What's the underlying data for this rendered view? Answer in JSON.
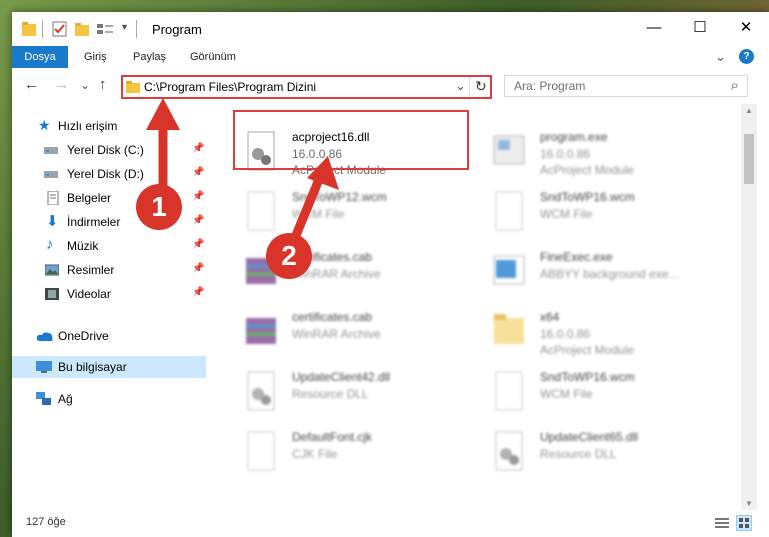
{
  "window": {
    "title": "Program",
    "minimize": "—",
    "maximize": "☐",
    "close": "✕"
  },
  "ribbon": {
    "tabs": [
      "Dosya",
      "Giriş",
      "Paylaş",
      "Görünüm"
    ],
    "expand": "⌄",
    "help": "?"
  },
  "nav": {
    "back": "←",
    "forward": "→",
    "recent": "⌄",
    "up": "↑",
    "address": "C:\\Program Files\\Program Dizini",
    "dropdown": "⌄",
    "refresh": "↻",
    "search_placeholder": "Ara: Program",
    "search_icon": "⌕"
  },
  "sidebar": {
    "items": [
      {
        "label": "Hızlı erişim",
        "icon": "star-icon",
        "pinned": false
      },
      {
        "label": "Yerel Disk (C:)",
        "icon": "drive-icon",
        "pinned": true
      },
      {
        "label": "Yerel Disk (D:)",
        "icon": "drive-icon",
        "pinned": true
      },
      {
        "label": "Belgeler",
        "icon": "document-icon",
        "pinned": true
      },
      {
        "label": "İndirmeler",
        "icon": "download-icon",
        "pinned": true
      },
      {
        "label": "Müzik",
        "icon": "music-icon",
        "pinned": true
      },
      {
        "label": "Resimler",
        "icon": "pictures-icon",
        "pinned": true
      },
      {
        "label": "Videolar",
        "icon": "video-icon",
        "pinned": true
      },
      {
        "label": "OneDrive",
        "icon": "cloud-icon",
        "pinned": false
      },
      {
        "label": "Bu bilgisayar",
        "icon": "computer-icon",
        "pinned": false
      },
      {
        "label": "Ağ",
        "icon": "network-icon",
        "pinned": false
      }
    ]
  },
  "files": [
    {
      "name": "acproject16.dll",
      "type": "16.0.0.86",
      "desc": "AcProject Module",
      "kind": "dll"
    },
    {
      "name": "program.exe",
      "type": "16.0.0.86",
      "desc": "AcProject Module",
      "kind": "exe"
    },
    {
      "name": "SndToWP12.wcm",
      "type": "WCM File",
      "desc": "",
      "kind": "blank"
    },
    {
      "name": "SndToWP16.wcm",
      "type": "WCM File",
      "desc": "",
      "kind": "blank"
    },
    {
      "name": "certificates.cab",
      "type": "WinRAR Archive",
      "desc": "",
      "kind": "rar"
    },
    {
      "name": "FineExec.exe",
      "type": "ABBYY background exe...",
      "desc": "",
      "kind": "exe2"
    },
    {
      "name": "certificates.cab",
      "type": "WinRAR Archive",
      "desc": "",
      "kind": "rar"
    },
    {
      "name": "x64",
      "type": "16.0.0.86",
      "desc": "AcProject Module",
      "kind": "folder"
    },
    {
      "name": "UpdateClient42.dll",
      "type": "Resource DLL",
      "desc": "",
      "kind": "dll"
    },
    {
      "name": "SndToWP16.wcm",
      "type": "WCM File",
      "desc": "",
      "kind": "blank"
    },
    {
      "name": "DefaultFont.cjk",
      "type": "CJK File",
      "desc": "",
      "kind": "blank"
    },
    {
      "name": "UpdateClient65.dll",
      "type": "Resource DLL",
      "desc": "",
      "kind": "dll"
    }
  ],
  "status": {
    "count": "127 öğe"
  },
  "annotations": {
    "step1": "1",
    "step2": "2"
  },
  "colors": {
    "accent": "#1979ca",
    "highlight": "#e03a3a",
    "bubble": "#d9342a",
    "selected": "#cce8ff"
  }
}
